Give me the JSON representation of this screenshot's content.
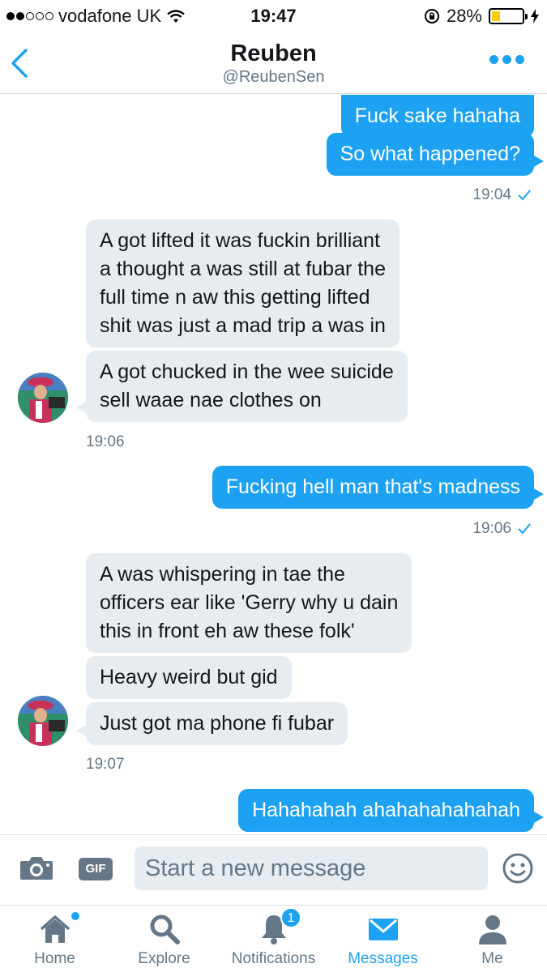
{
  "status_bar": {
    "carrier": "vodafone UK",
    "time": "19:47",
    "battery": "28%",
    "battery_level": 0.28,
    "signal_bars": 2,
    "icons": [
      "wifi-icon",
      "rotation-lock-icon",
      "battery-icon",
      "charging-icon"
    ]
  },
  "header": {
    "name": "Reuben",
    "handle": "@ReubenSen"
  },
  "messages": [
    {
      "direction": "out",
      "text": "Fuck sake hahaha"
    },
    {
      "direction": "out",
      "text": "So what happened?"
    },
    {
      "timestamp": "19:04",
      "direction": "out"
    },
    {
      "direction": "in",
      "lines": [
        "A got lifted it was fuckin brilliant",
        "a thought a was still at fubar the",
        "full time n aw this getting lifted",
        "shit was just a mad trip a was in"
      ]
    },
    {
      "direction": "in",
      "lines": [
        "A got chucked in the wee suicide",
        "sell waae nae clothes on"
      ]
    },
    {
      "timestamp": "19:06",
      "direction": "in"
    },
    {
      "direction": "out",
      "text": "Fucking hell man that's madness"
    },
    {
      "timestamp": "19:06",
      "direction": "out"
    },
    {
      "direction": "in",
      "lines": [
        "A was whispering in tae the",
        "officers ear like 'Gerry why u dain",
        "this in front eh aw these folk'"
      ]
    },
    {
      "direction": "in",
      "text": "Heavy weird but gid"
    },
    {
      "direction": "in",
      "text": "Just got ma phone fi fubar"
    },
    {
      "timestamp": "19:07",
      "direction": "in"
    },
    {
      "direction": "out",
      "text": "Hahahahah ahahahahahahah"
    }
  ],
  "composer": {
    "placeholder": "Start a new message",
    "gif_label": "GIF"
  },
  "tabs": [
    {
      "label": "Home",
      "icon": "home-icon"
    },
    {
      "label": "Explore",
      "icon": "search-icon"
    },
    {
      "label": "Notifications",
      "icon": "bell-icon",
      "badge": "1"
    },
    {
      "label": "Messages",
      "icon": "envelope-icon",
      "active": true
    },
    {
      "label": "Me",
      "icon": "person-icon"
    }
  ],
  "colors": {
    "accent": "#1da1f2",
    "incoming_bubble": "#e6ecf0",
    "secondary_text": "#657786",
    "battery_fill": "#ffcc00"
  }
}
